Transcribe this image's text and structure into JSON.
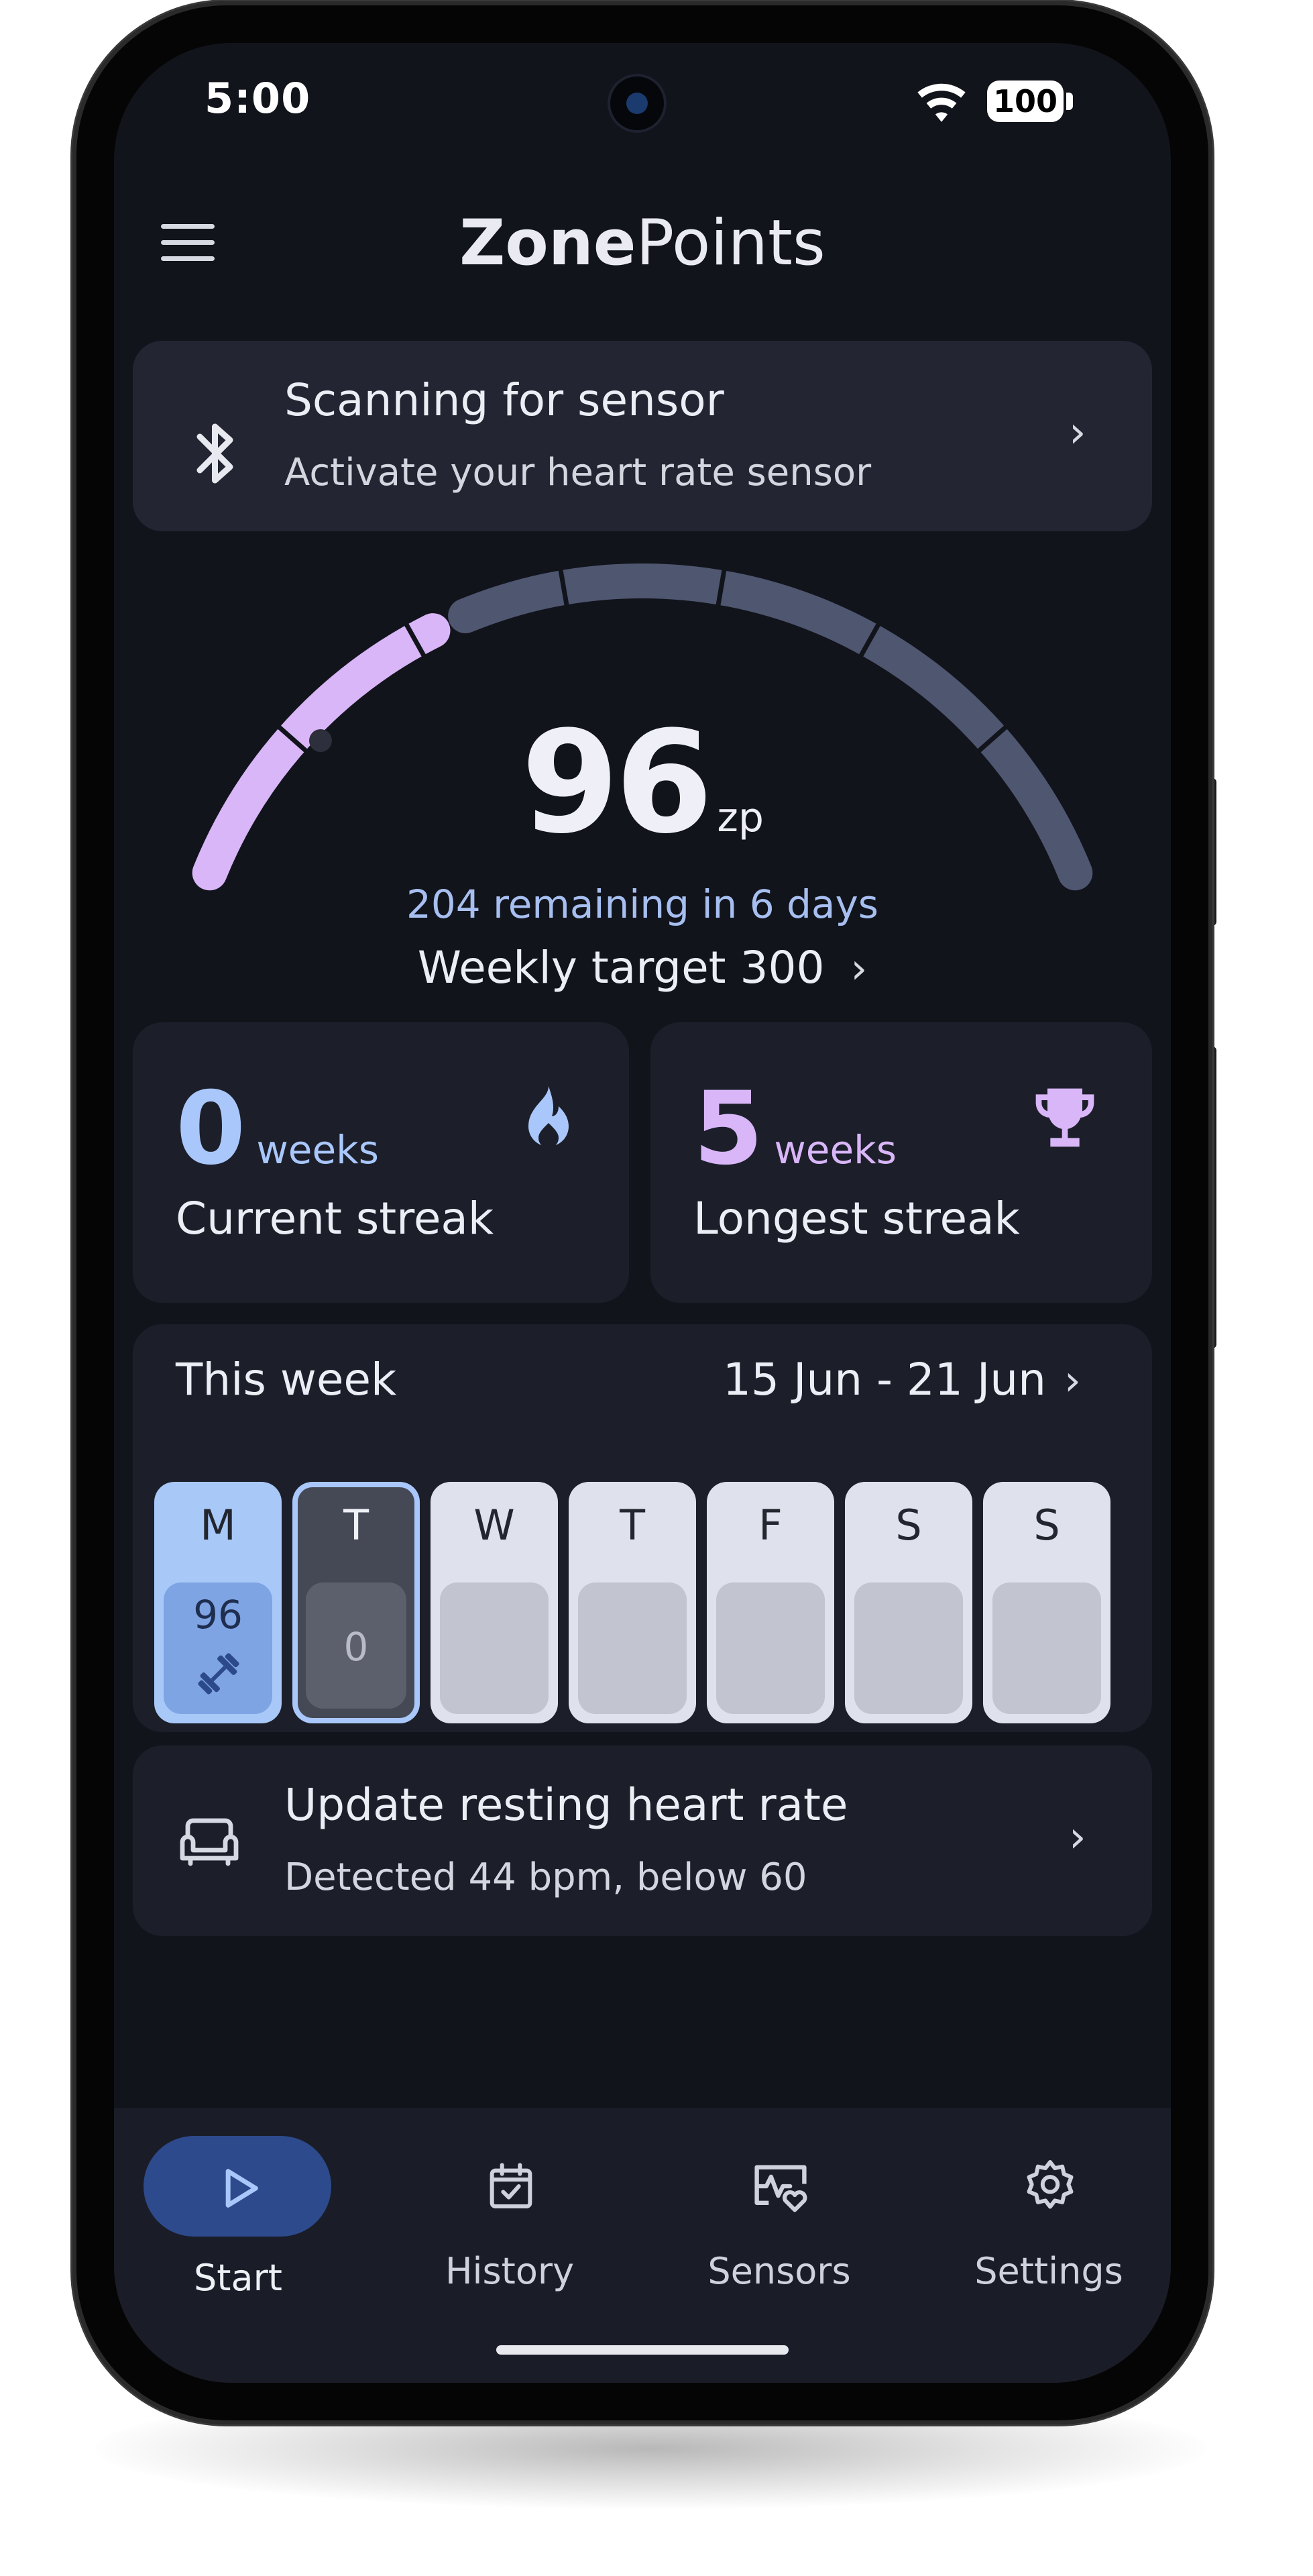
{
  "status": {
    "time": "5:00",
    "battery": "100"
  },
  "app": {
    "title_bold": "Zone",
    "title_rest": "Points"
  },
  "sensor_card": {
    "title": "Scanning for sensor",
    "subtitle": "Activate your heart rate sensor"
  },
  "gauge": {
    "points": "96",
    "unit": "zp",
    "remaining": "204 remaining in 6 days",
    "target_label": "Weekly target 300",
    "progress_fraction": 0.32,
    "color_filled": "#d9b6f8",
    "color_empty": "#4f5670"
  },
  "streaks": {
    "current": {
      "value": "0",
      "unit": "weeks",
      "label": "Current streak",
      "icon": "flame-icon",
      "color": "#a9c7fa"
    },
    "longest": {
      "value": "5",
      "unit": "weeks",
      "label": "Longest streak",
      "icon": "trophy-icon",
      "color": "#d9b6f8"
    }
  },
  "week": {
    "title": "This week",
    "range": "15 Jun - 21 Jun",
    "days": [
      {
        "letter": "M",
        "points": "96",
        "icon": "dumbbell-icon"
      },
      {
        "letter": "T",
        "points": "0"
      },
      {
        "letter": "W"
      },
      {
        "letter": "T"
      },
      {
        "letter": "F"
      },
      {
        "letter": "S"
      },
      {
        "letter": "S"
      }
    ]
  },
  "rhr_card": {
    "title": "Update resting heart rate",
    "subtitle": "Detected 44 bpm, below 60",
    "icon": "sofa-icon"
  },
  "nav": [
    {
      "label": "Start",
      "icon": "play-icon",
      "active": true
    },
    {
      "label": "History",
      "icon": "calendar-check-icon"
    },
    {
      "label": "Sensors",
      "icon": "heart-monitor-icon"
    },
    {
      "label": "Settings",
      "icon": "gear-icon"
    }
  ]
}
